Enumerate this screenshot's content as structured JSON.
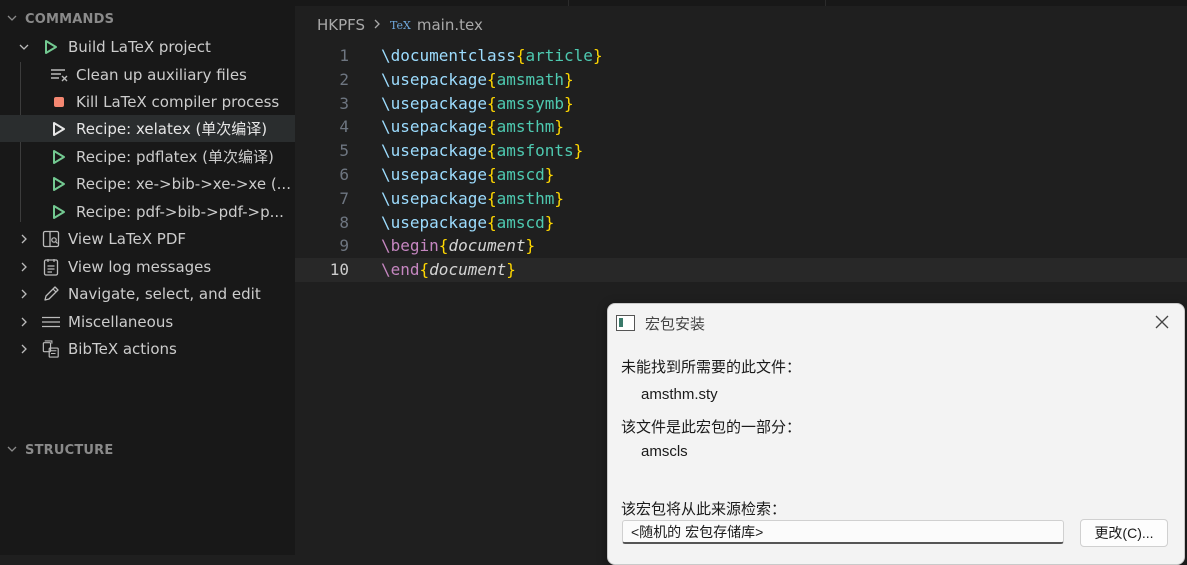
{
  "sidebar": {
    "commands_header": "COMMANDS",
    "structure_header": "STRUCTURE",
    "items": [
      {
        "label": "Build LaTeX project",
        "icon": "play-icon",
        "expanded": true
      },
      {
        "label": "Clean up auxiliary files",
        "icon": "clear-all-icon"
      },
      {
        "label": "Kill LaTeX compiler process",
        "icon": "stop-icon"
      },
      {
        "label": "Recipe: xelatex (单次编译)",
        "icon": "play-outline-icon",
        "selected": true
      },
      {
        "label": "Recipe: pdflatex (单次编译)",
        "icon": "play-icon"
      },
      {
        "label": "Recipe: xe->bib->xe->xe (...",
        "icon": "play-icon"
      },
      {
        "label": "Recipe: pdf->bib->pdf->p...",
        "icon": "play-icon"
      },
      {
        "label": "View LaTeX PDF",
        "icon": "open-preview-icon"
      },
      {
        "label": "View log messages",
        "icon": "output-icon"
      },
      {
        "label": "Navigate, select, and edit",
        "icon": "edit-icon"
      },
      {
        "label": "Miscellaneous",
        "icon": "menu-icon"
      },
      {
        "label": "BibTeX actions",
        "icon": "references-icon"
      }
    ]
  },
  "breadcrumb": {
    "folder": "HKPFS",
    "file_icon": "TeX",
    "file": "main.tex"
  },
  "editor": {
    "current_line": 10,
    "lines": [
      {
        "n": "1",
        "cmd": "\\documentclass",
        "arg": "article"
      },
      {
        "n": "2",
        "cmd": "\\usepackage",
        "arg": "amsmath"
      },
      {
        "n": "3",
        "cmd": "\\usepackage",
        "arg": "amssymb"
      },
      {
        "n": "4",
        "cmd": "\\usepackage",
        "arg": "amsthm"
      },
      {
        "n": "5",
        "cmd": "\\usepackage",
        "arg": "amsfonts"
      },
      {
        "n": "6",
        "cmd": "\\usepackage",
        "arg": "amscd"
      },
      {
        "n": "7",
        "cmd": "\\usepackage",
        "arg": "amsthm"
      },
      {
        "n": "8",
        "cmd": "\\usepackage",
        "arg": "amscd"
      },
      {
        "n": "9",
        "cmd": "\\begin",
        "arg": "document"
      },
      {
        "n": "10",
        "cmd": "\\end",
        "arg": "document"
      }
    ]
  },
  "dialog": {
    "title": "宏包安装",
    "missing_label": "未能找到所需要的此文件：",
    "missing_file": "amsthm.sty",
    "package_label": "该文件是此宏包的一部分：",
    "package_name": "amscls",
    "source_label": "该宏包将从此来源检索：",
    "source_value": "<随机的 宏包存储库>",
    "change_button": "更改(C)..."
  }
}
